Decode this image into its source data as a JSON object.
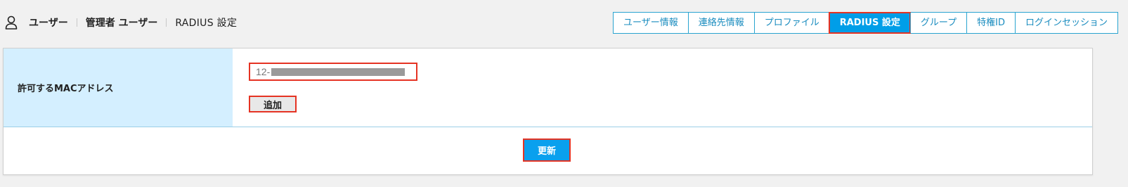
{
  "breadcrumb": {
    "items": [
      "ユーザー",
      "管理者 ユーザー",
      "RADIUS 設定"
    ]
  },
  "tabs": [
    {
      "label": "ユーザー情報",
      "active": false
    },
    {
      "label": "連絡先情報",
      "active": false
    },
    {
      "label": "プロファイル",
      "active": false
    },
    {
      "label": "RADIUS 設定",
      "active": true
    },
    {
      "label": "グループ",
      "active": false
    },
    {
      "label": "特権ID",
      "active": false
    },
    {
      "label": "ログインセッション",
      "active": false
    }
  ],
  "form": {
    "mac_label": "許可するMACアドレス",
    "mac_value_visible": "12-",
    "add_label": "追加",
    "update_label": "更新"
  },
  "icons": {
    "user": "user-icon"
  },
  "colors": {
    "accent": "#009ee8",
    "tab_border": "#2aa4d0",
    "label_bg": "#d4efff",
    "highlight": "#e53323"
  }
}
